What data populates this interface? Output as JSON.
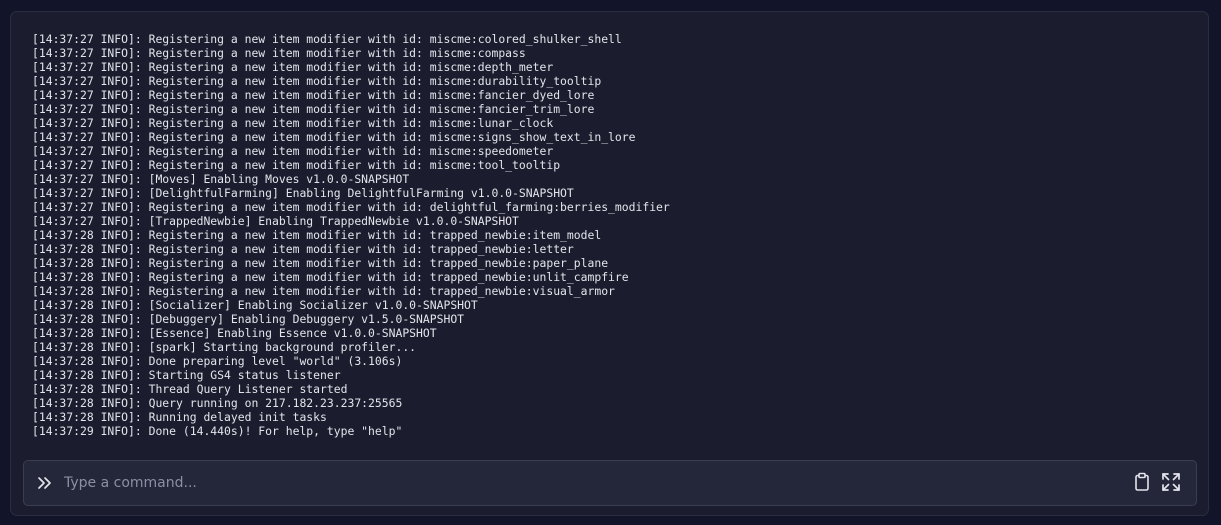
{
  "console": {
    "lines": [
      "[14:37:27 INFO]: Registering a new item modifier with id: miscme:colored_shulker_shell",
      "[14:37:27 INFO]: Registering a new item modifier with id: miscme:compass",
      "[14:37:27 INFO]: Registering a new item modifier with id: miscme:depth_meter",
      "[14:37:27 INFO]: Registering a new item modifier with id: miscme:durability_tooltip",
      "[14:37:27 INFO]: Registering a new item modifier with id: miscme:fancier_dyed_lore",
      "[14:37:27 INFO]: Registering a new item modifier with id: miscme:fancier_trim_lore",
      "[14:37:27 INFO]: Registering a new item modifier with id: miscme:lunar_clock",
      "[14:37:27 INFO]: Registering a new item modifier with id: miscme:signs_show_text_in_lore",
      "[14:37:27 INFO]: Registering a new item modifier with id: miscme:speedometer",
      "[14:37:27 INFO]: Registering a new item modifier with id: miscme:tool_tooltip",
      "[14:37:27 INFO]: [Moves] Enabling Moves v1.0.0-SNAPSHOT",
      "[14:37:27 INFO]: [DelightfulFarming] Enabling DelightfulFarming v1.0.0-SNAPSHOT",
      "[14:37:27 INFO]: Registering a new item modifier with id: delightful_farming:berries_modifier",
      "[14:37:27 INFO]: [TrappedNewbie] Enabling TrappedNewbie v1.0.0-SNAPSHOT",
      "[14:37:28 INFO]: Registering a new item modifier with id: trapped_newbie:item_model",
      "[14:37:28 INFO]: Registering a new item modifier with id: trapped_newbie:letter",
      "[14:37:28 INFO]: Registering a new item modifier with id: trapped_newbie:paper_plane",
      "[14:37:28 INFO]: Registering a new item modifier with id: trapped_newbie:unlit_campfire",
      "[14:37:28 INFO]: Registering a new item modifier with id: trapped_newbie:visual_armor",
      "[14:37:28 INFO]: [Socializer] Enabling Socializer v1.0.0-SNAPSHOT",
      "[14:37:28 INFO]: [Debuggery] Enabling Debuggery v1.5.0-SNAPSHOT",
      "[14:37:28 INFO]: [Essence] Enabling Essence v1.0.0-SNAPSHOT",
      "[14:37:28 INFO]: [spark] Starting background profiler...",
      "[14:37:28 INFO]: Done preparing level \"world\" (3.106s)",
      "[14:37:28 INFO]: Starting GS4 status listener",
      "[14:37:28 INFO]: Thread Query Listener started",
      "[14:37:28 INFO]: Query running on 217.182.23.237:25565",
      "[14:37:28 INFO]: Running delayed init tasks",
      "[14:37:29 INFO]: Done (14.440s)! For help, type \"help\""
    ]
  },
  "command_bar": {
    "placeholder": "Type a command...",
    "value": "",
    "prompt_icon": "chevrons-right-icon",
    "buttons": [
      {
        "name": "clipboard-button",
        "icon": "clipboard-icon"
      },
      {
        "name": "fullscreen-button",
        "icon": "expand-icon"
      }
    ]
  },
  "colors": {
    "background": "#12142a",
    "panel": "#1b1d2e",
    "input_background": "#24263a",
    "text": "#e4e4ec",
    "placeholder": "#8c8fa3"
  }
}
